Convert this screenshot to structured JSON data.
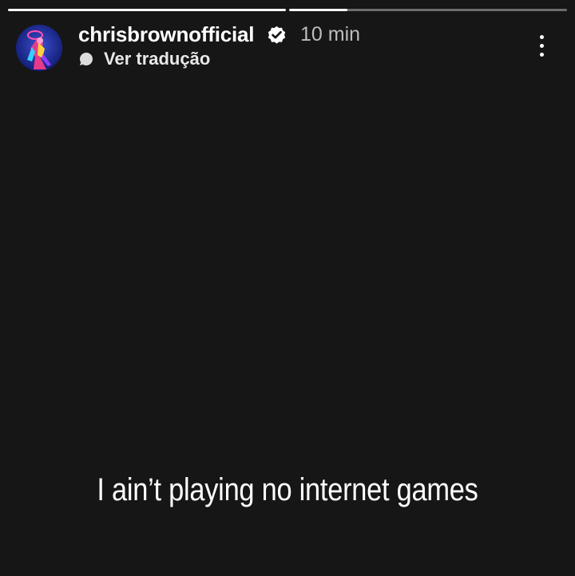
{
  "story": {
    "progress": [
      {
        "segment": 1,
        "fraction": 1.0
      },
      {
        "segment": 2,
        "fraction": 0.21
      }
    ],
    "header": {
      "username": "chrisbrownofficial",
      "verified": true,
      "timestamp": "10 min",
      "translate_label": "Ver tradução",
      "translate_icon": "speech-bubble-icon",
      "more_icon": "more-vertical-icon"
    },
    "caption": "I ain’t playing no internet games"
  },
  "colors": {
    "background": "#161616",
    "text": "#ffffff",
    "timestamp": "#bdbdbd",
    "progress_track": "rgba(255,255,255,0.38)"
  }
}
